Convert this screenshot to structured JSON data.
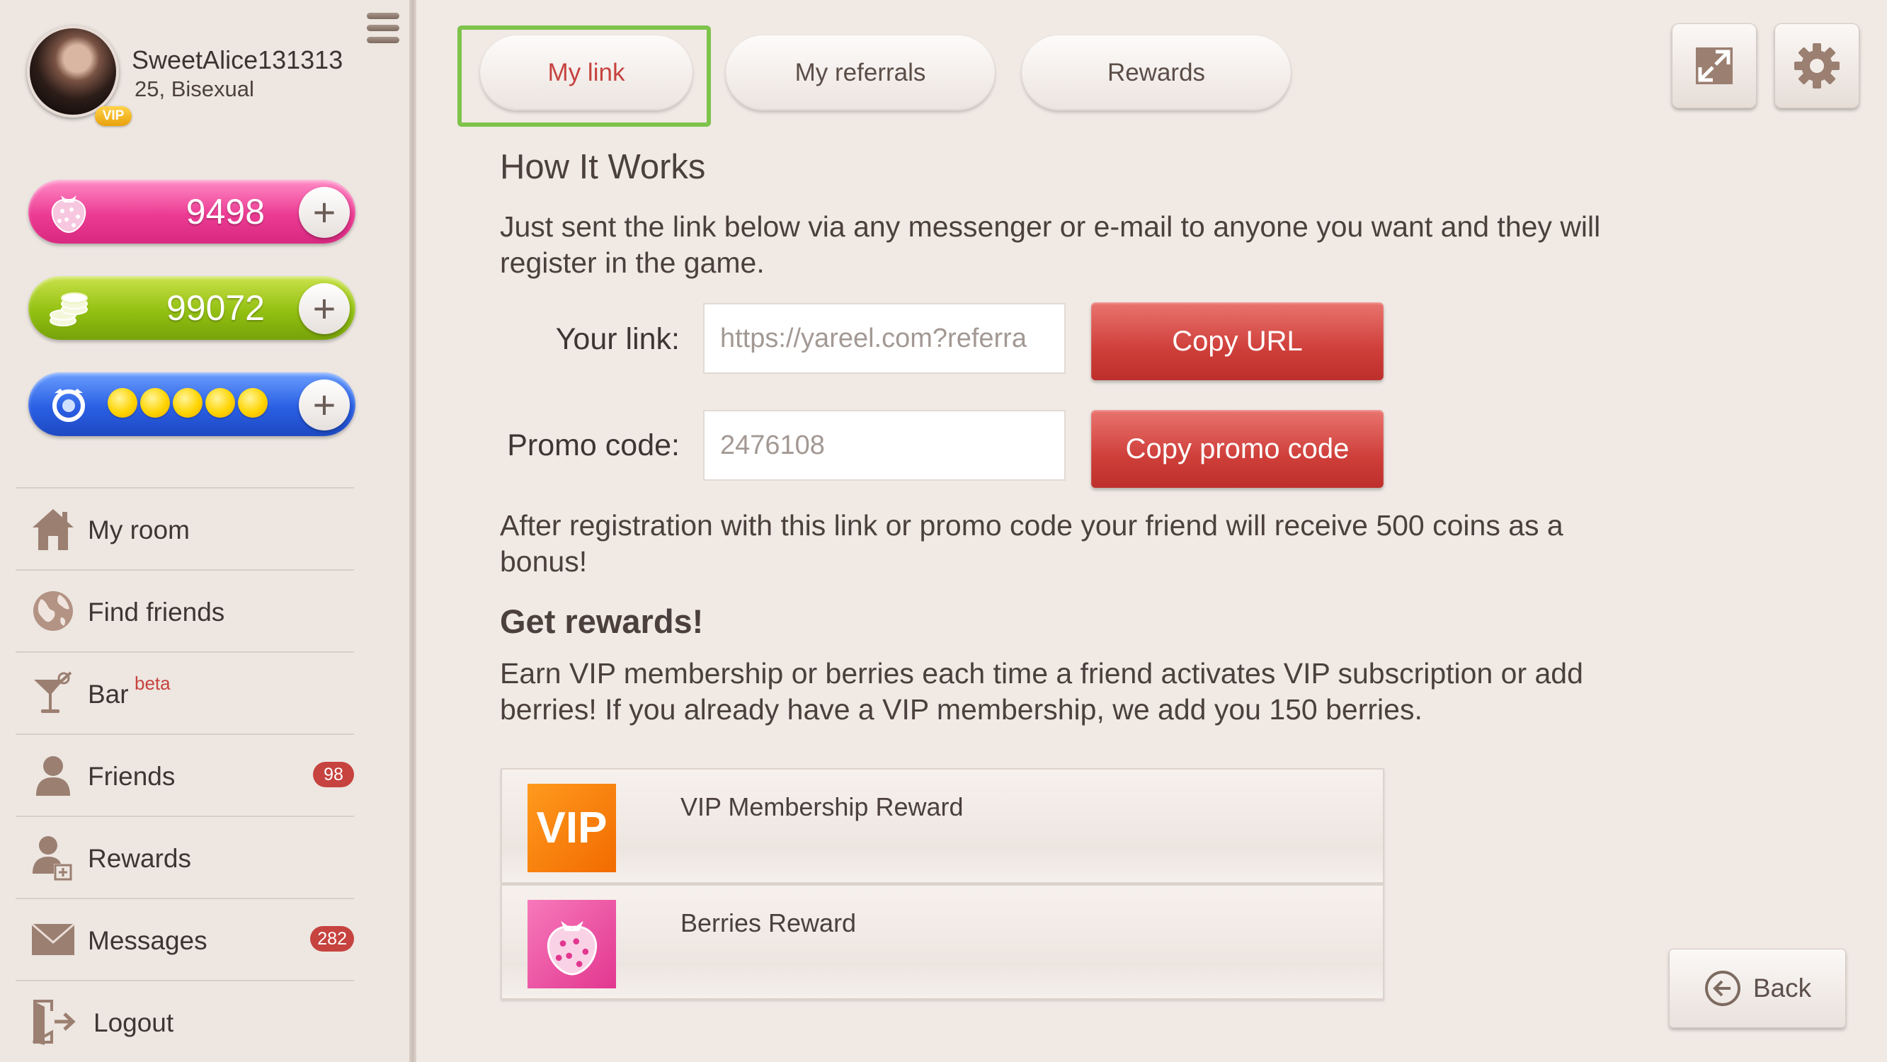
{
  "profile": {
    "username": "SweetAlice131313",
    "meta": "25, Bisexual",
    "vip_badge": "VIP"
  },
  "currencies": {
    "berries": "9498",
    "coins": "99072",
    "energy_level": 5,
    "energy_max": 5
  },
  "nav": {
    "my_room": "My room",
    "find_friends": "Find friends",
    "bar": "Bar",
    "bar_tag": "beta",
    "friends": "Friends",
    "friends_count": "98",
    "rewards": "Rewards",
    "messages": "Messages",
    "messages_count": "282",
    "logout": "Logout"
  },
  "tabs": {
    "my_link": "My link",
    "my_referrals": "My referrals",
    "rewards": "Rewards",
    "active": "my_link"
  },
  "content": {
    "how_title": "How It Works",
    "how_text": "Just sent the link below via any messenger or e-mail to anyone you want and they will register in the game.",
    "link_label": "Your link:",
    "link_value": "https://yareel.com?referra",
    "copy_url": "Copy URL",
    "promo_label": "Promo code:",
    "promo_value": "2476108",
    "copy_promo": "Copy promo code",
    "after_text": "After registration with this link or promo code your friend will receive 500 coins as a bonus!",
    "rewards_title": "Get rewards!",
    "rewards_text": "Earn VIP membership or berries each time a friend activates VIP subscription or add berries! If you already have a VIP membership, we add you 150 berries.",
    "vip_icon_text": "VIP",
    "vip_reward": "VIP Membership Reward",
    "berries_reward": "Berries Reward"
  },
  "back_label": "Back",
  "colors": {
    "accent_red": "#c6433f",
    "highlight_green": "#7ec34a",
    "berries_pink": "#ec3b93",
    "coins_green": "#93c012",
    "energy_blue": "#2a5fe4",
    "vip_orange": "#f26b00"
  },
  "icons": {
    "hamburger": "hamburger-menu-icon",
    "berry": "strawberry-icon",
    "coins": "coin-stack-icon",
    "energy": "energy-icon",
    "home": "home-icon",
    "globe": "globe-icon",
    "cocktail": "cocktail-icon",
    "person": "person-icon",
    "reward_person": "person-reward-icon",
    "envelope": "envelope-icon",
    "logout": "logout-door-icon",
    "fullscreen": "fullscreen-icon",
    "settings": "gear-icon",
    "back": "back-arrow-icon"
  }
}
